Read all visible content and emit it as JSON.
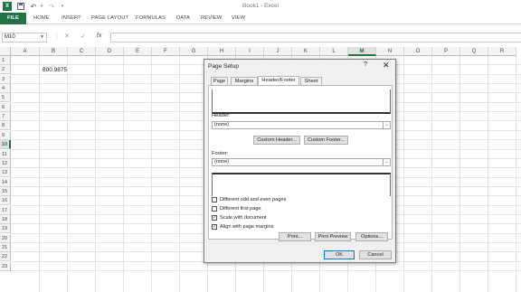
{
  "window": {
    "title": "Book1 - Excel"
  },
  "ribbon": {
    "tabs": [
      "FILE",
      "HOME",
      "INSERT",
      "PAGE LAYOUT",
      "FORMULAS",
      "DATA",
      "REVIEW",
      "VIEW"
    ]
  },
  "formula_bar": {
    "name_box": "M10",
    "fx": "fx",
    "value": ""
  },
  "sheet": {
    "columns": [
      "A",
      "B",
      "C",
      "D",
      "E",
      "F",
      "G",
      "H",
      "I",
      "J",
      "K",
      "L",
      "M",
      "N",
      "O",
      "P",
      "Q",
      "R"
    ],
    "rows": [
      "1",
      "2",
      "3",
      "4",
      "5",
      "6",
      "7",
      "8",
      "9",
      "10",
      "11",
      "12",
      "13",
      "14",
      "15",
      "16",
      "17",
      "18",
      "19",
      "20",
      "21",
      "22",
      "23"
    ],
    "active_cell": "M10",
    "cells": {
      "B2": "800.9875"
    }
  },
  "dialog": {
    "title": "Page Setup",
    "help": "?",
    "close": "✕",
    "tabs": [
      "Page",
      "Margins",
      "Header/Footer",
      "Sheet"
    ],
    "selected_tab": "Header/Footer",
    "header_label": "Header:",
    "header_value": "(none)",
    "custom_header": "Custom Header...",
    "custom_footer": "Custom Footer...",
    "footer_label": "Footer:",
    "footer_value": "(none)",
    "options": [
      {
        "label": "Different odd and even pages",
        "checked": false
      },
      {
        "label": "Different first page",
        "checked": false
      },
      {
        "label": "Scale with document",
        "checked": true
      },
      {
        "label": "Align with page margins",
        "checked": true
      }
    ],
    "print": "Print...",
    "print_preview": "Print Preview",
    "options_button": "Options...",
    "ok": "OK",
    "cancel": "Cancel"
  },
  "colors": {
    "accent": "#217346",
    "grid": "#e3e3e3",
    "dialog_bg": "#f0f0f0"
  }
}
